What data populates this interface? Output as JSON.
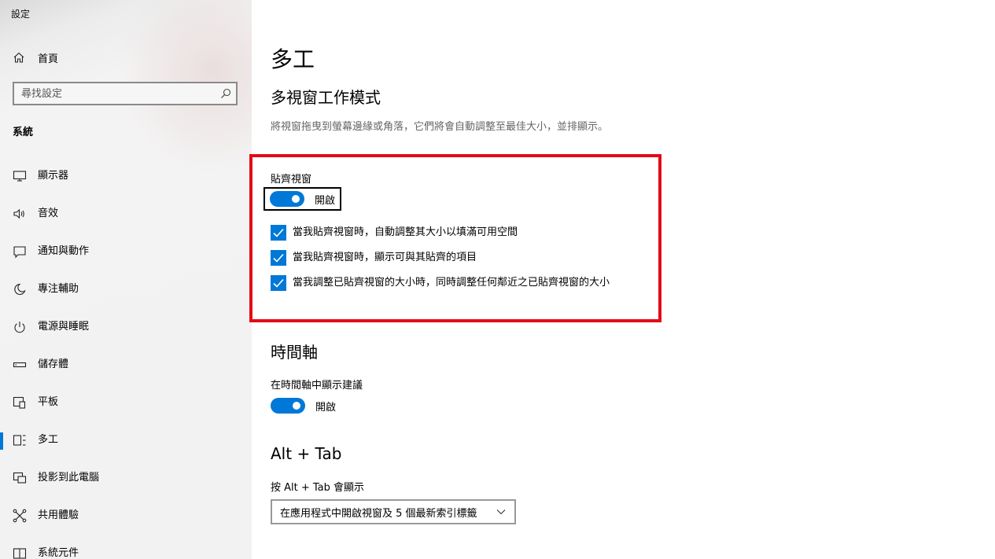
{
  "app": {
    "title": "設定"
  },
  "sidebar": {
    "home_label": "首頁",
    "search_placeholder": "尋找設定",
    "section_label": "系統",
    "items": [
      {
        "label": "顯示器",
        "icon": "monitor-icon"
      },
      {
        "label": "音效",
        "icon": "speaker-icon"
      },
      {
        "label": "通知與動作",
        "icon": "notification-icon"
      },
      {
        "label": "專注輔助",
        "icon": "moon-icon"
      },
      {
        "label": "電源與睡眠",
        "icon": "power-icon"
      },
      {
        "label": "儲存體",
        "icon": "storage-icon"
      },
      {
        "label": "平板",
        "icon": "tablet-icon"
      },
      {
        "label": "多工",
        "icon": "multitasking-icon",
        "active": true
      },
      {
        "label": "投影到此電腦",
        "icon": "project-icon"
      },
      {
        "label": "共用體驗",
        "icon": "shared-experience-icon"
      },
      {
        "label": "系統元件",
        "icon": "system-components-icon"
      }
    ]
  },
  "main": {
    "title": "多工",
    "snap": {
      "heading": "多視窗工作模式",
      "description": "將視窗拖曳到螢幕邊緣或角落，它們將會自動調整至最佳大小，並排顯示。",
      "toggle_label": "貼齊視窗",
      "toggle_state": "開啟",
      "checkboxes": [
        {
          "label": "當我貼齊視窗時，自動調整其大小以填滿可用空間",
          "checked": true
        },
        {
          "label": "當我貼齊視窗時，顯示可與其貼齊的項目",
          "checked": true
        },
        {
          "label": "當我調整已貼齊視窗的大小時，同時調整任何鄰近之已貼齊視窗的大小",
          "checked": true
        }
      ]
    },
    "timeline": {
      "heading": "時間軸",
      "toggle_label": "在時間軸中顯示建議",
      "toggle_state": "開啟"
    },
    "alttab": {
      "heading": "Alt + Tab",
      "label": "按 Alt + Tab 會顯示",
      "selected": "在應用程式中開啟視窗及 5 個最新索引標籤"
    }
  },
  "colors": {
    "accent": "#0078d7",
    "highlight_box": "#e30b17"
  }
}
